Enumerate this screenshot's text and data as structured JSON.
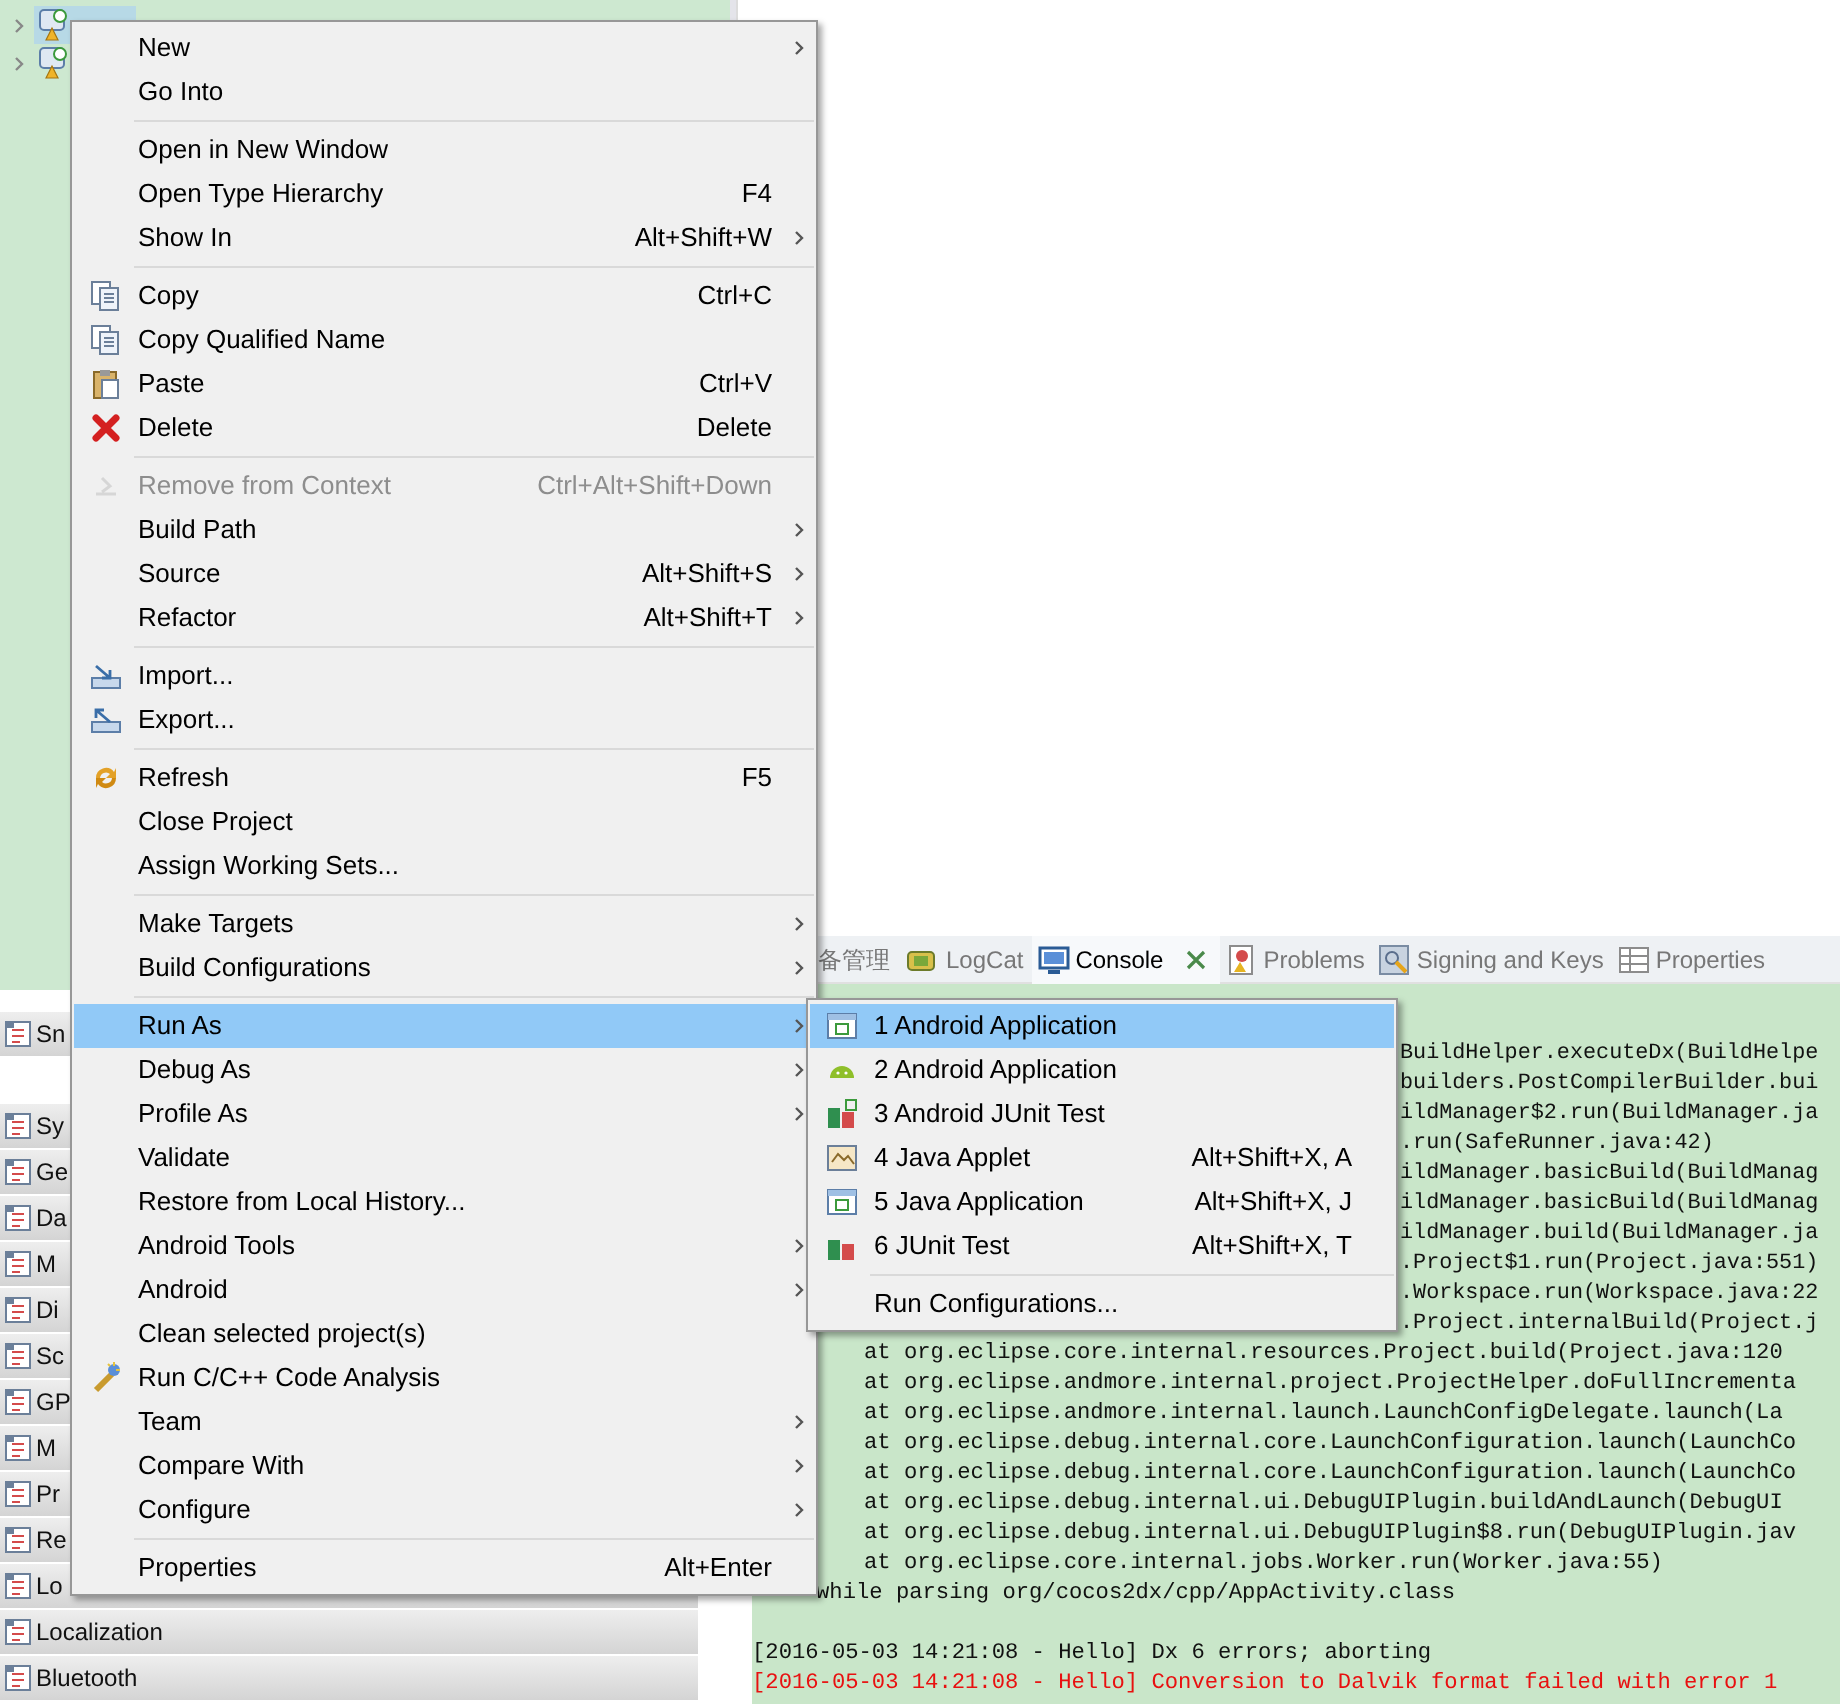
{
  "project_tree": {
    "items": [
      {
        "selected": true
      },
      {
        "selected": false
      }
    ]
  },
  "palette": {
    "groups": [
      "Sn",
      "Sy",
      "Ge",
      "Da",
      "M",
      "Di",
      "Sc",
      "GP",
      "M",
      "Pr",
      "Re",
      "Lo",
      "Localization",
      "Bluetooth"
    ]
  },
  "console_tabs": [
    {
      "label": "备管理",
      "selected": false
    },
    {
      "label": "LogCat",
      "selected": false
    },
    {
      "label": "Console",
      "selected": true
    },
    {
      "label": "Problems",
      "selected": false
    },
    {
      "label": "Signing and Keys",
      "selected": false
    },
    {
      "label": "Properties",
      "selected": false
    }
  ],
  "console": {
    "partial_lines": [
      "BuildHelper.executeDx(BuildHelpe",
      "builders.PostCompilerBuilder.bui",
      "ildManager$2.run(BuildManager.ja",
      ".run(SafeRunner.java:42)",
      "ildManager.basicBuild(BuildManag",
      "ildManager.basicBuild(BuildManag",
      "ildManager.build(BuildManager.ja",
      ".Project$1.run(Project.java:551)",
      ".Workspace.run(Workspace.java:22",
      ".Project.internalBuild(Project.j"
    ],
    "lines": [
      {
        "text": "at org.eclipse.core.internal.resources.Project.build(Project.java:120",
        "kind": "trace"
      },
      {
        "text": "at org.eclipse.andmore.internal.project.ProjectHelper.doFullIncrementa",
        "kind": "trace"
      },
      {
        "text": "at org.eclipse.andmore.internal.launch.LaunchConfigDelegate.launch(La",
        "kind": "trace"
      },
      {
        "text": "at org.eclipse.debug.internal.core.LaunchConfiguration.launch(LaunchCo",
        "kind": "trace"
      },
      {
        "text": "at org.eclipse.debug.internal.core.LaunchConfiguration.launch(LaunchCo",
        "kind": "trace"
      },
      {
        "text": "at org.eclipse.debug.internal.ui.DebugUIPlugin.buildAndLaunch(DebugUI",
        "kind": "trace"
      },
      {
        "text": "at org.eclipse.debug.internal.ui.DebugUIPlugin$8.run(DebugUIPlugin.jav",
        "kind": "trace"
      },
      {
        "text": "at org.eclipse.core.internal.jobs.Worker.run(Worker.java:55)",
        "kind": "trace"
      },
      {
        "text": "while parsing org/cocos2dx/cpp/AppActivity.class",
        "kind": "continued"
      },
      {
        "kind": "blank"
      },
      {
        "text": "[2016-05-03 14:21:08 - Hello] Dx 6 errors; aborting",
        "kind": "normal"
      },
      {
        "text": "[2016-05-03 14:21:08 - Hello] Conversion to Dalvik format failed with error 1",
        "kind": "error"
      }
    ]
  },
  "context_menu": {
    "items": [
      {
        "kind": "item",
        "label": "New",
        "submenu": true,
        "selected": false,
        "disabled": false
      },
      {
        "kind": "item",
        "label": "Go Into",
        "selected": false,
        "disabled": false
      },
      {
        "kind": "separator"
      },
      {
        "kind": "item",
        "label": "Open in New Window",
        "selected": false,
        "disabled": false
      },
      {
        "kind": "item",
        "label": "Open Type Hierarchy",
        "shortcut": "F4",
        "selected": false,
        "disabled": false
      },
      {
        "kind": "item",
        "label": "Show In",
        "shortcut": "Alt+Shift+W",
        "submenu": true,
        "selected": false,
        "disabled": false
      },
      {
        "kind": "separator"
      },
      {
        "kind": "item",
        "label": "Copy",
        "shortcut": "Ctrl+C",
        "selected": false,
        "disabled": false
      },
      {
        "kind": "item",
        "label": "Copy Qualified Name",
        "selected": false,
        "disabled": false
      },
      {
        "kind": "item",
        "label": "Paste",
        "shortcut": "Ctrl+V",
        "selected": false,
        "disabled": false
      },
      {
        "kind": "item",
        "label": "Delete",
        "shortcut": "Delete",
        "selected": false,
        "disabled": false
      },
      {
        "kind": "separator"
      },
      {
        "kind": "item",
        "label": "Remove from Context",
        "shortcut": "Ctrl+Alt+Shift+Down",
        "selected": false,
        "disabled": true
      },
      {
        "kind": "item",
        "label": "Build Path",
        "submenu": true,
        "selected": false,
        "disabled": false
      },
      {
        "kind": "item",
        "label": "Source",
        "shortcut": "Alt+Shift+S",
        "submenu": true,
        "selected": false,
        "disabled": false
      },
      {
        "kind": "item",
        "label": "Refactor",
        "shortcut": "Alt+Shift+T",
        "submenu": true,
        "selected": false,
        "disabled": false
      },
      {
        "kind": "separator"
      },
      {
        "kind": "item",
        "label": "Import...",
        "selected": false,
        "disabled": false
      },
      {
        "kind": "item",
        "label": "Export...",
        "selected": false,
        "disabled": false
      },
      {
        "kind": "separator"
      },
      {
        "kind": "item",
        "label": "Refresh",
        "shortcut": "F5",
        "selected": false,
        "disabled": false
      },
      {
        "kind": "item",
        "label": "Close Project",
        "selected": false,
        "disabled": false
      },
      {
        "kind": "item",
        "label": "Assign Working Sets...",
        "selected": false,
        "disabled": false
      },
      {
        "kind": "separator"
      },
      {
        "kind": "item",
        "label": "Make Targets",
        "submenu": true,
        "selected": false,
        "disabled": false
      },
      {
        "kind": "item",
        "label": "Build Configurations",
        "submenu": true,
        "selected": false,
        "disabled": false
      },
      {
        "kind": "separator"
      },
      {
        "kind": "item",
        "label": "Run As",
        "submenu": true,
        "selected": true,
        "disabled": false
      },
      {
        "kind": "item",
        "label": "Debug As",
        "submenu": true,
        "selected": false,
        "disabled": false
      },
      {
        "kind": "item",
        "label": "Profile As",
        "submenu": true,
        "selected": false,
        "disabled": false
      },
      {
        "kind": "item",
        "label": "Validate",
        "selected": false,
        "disabled": false
      },
      {
        "kind": "item",
        "label": "Restore from Local History...",
        "selected": false,
        "disabled": false
      },
      {
        "kind": "item",
        "label": "Android Tools",
        "submenu": true,
        "selected": false,
        "disabled": false
      },
      {
        "kind": "item",
        "label": "Android",
        "submenu": true,
        "selected": false,
        "disabled": false
      },
      {
        "kind": "item",
        "label": "Clean selected project(s)",
        "selected": false,
        "disabled": false
      },
      {
        "kind": "item",
        "label": "Run C/C++ Code Analysis",
        "selected": false,
        "disabled": false
      },
      {
        "kind": "item",
        "label": "Team",
        "submenu": true,
        "selected": false,
        "disabled": false
      },
      {
        "kind": "item",
        "label": "Compare With",
        "submenu": true,
        "selected": false,
        "disabled": false
      },
      {
        "kind": "item",
        "label": "Configure",
        "submenu": true,
        "selected": false,
        "disabled": false
      },
      {
        "kind": "separator"
      },
      {
        "kind": "item",
        "label": "Properties",
        "shortcut": "Alt+Enter",
        "selected": false,
        "disabled": false
      }
    ]
  },
  "run_as_menu": {
    "items": [
      {
        "kind": "item",
        "label": "1 Android Application",
        "selected": true
      },
      {
        "kind": "item",
        "label": "2 Android Application",
        "selected": false
      },
      {
        "kind": "item",
        "label": "3 Android JUnit Test",
        "selected": false
      },
      {
        "kind": "item",
        "label": "4 Java Applet",
        "shortcut": "Alt+Shift+X, A",
        "selected": false
      },
      {
        "kind": "item",
        "label": "5 Java Application",
        "shortcut": "Alt+Shift+X, J",
        "selected": false
      },
      {
        "kind": "item",
        "label": "6 JUnit Test",
        "shortcut": "Alt+Shift+X, T",
        "selected": false
      },
      {
        "kind": "separator"
      },
      {
        "kind": "item",
        "label": "Run Configurations...",
        "selected": false
      }
    ]
  }
}
